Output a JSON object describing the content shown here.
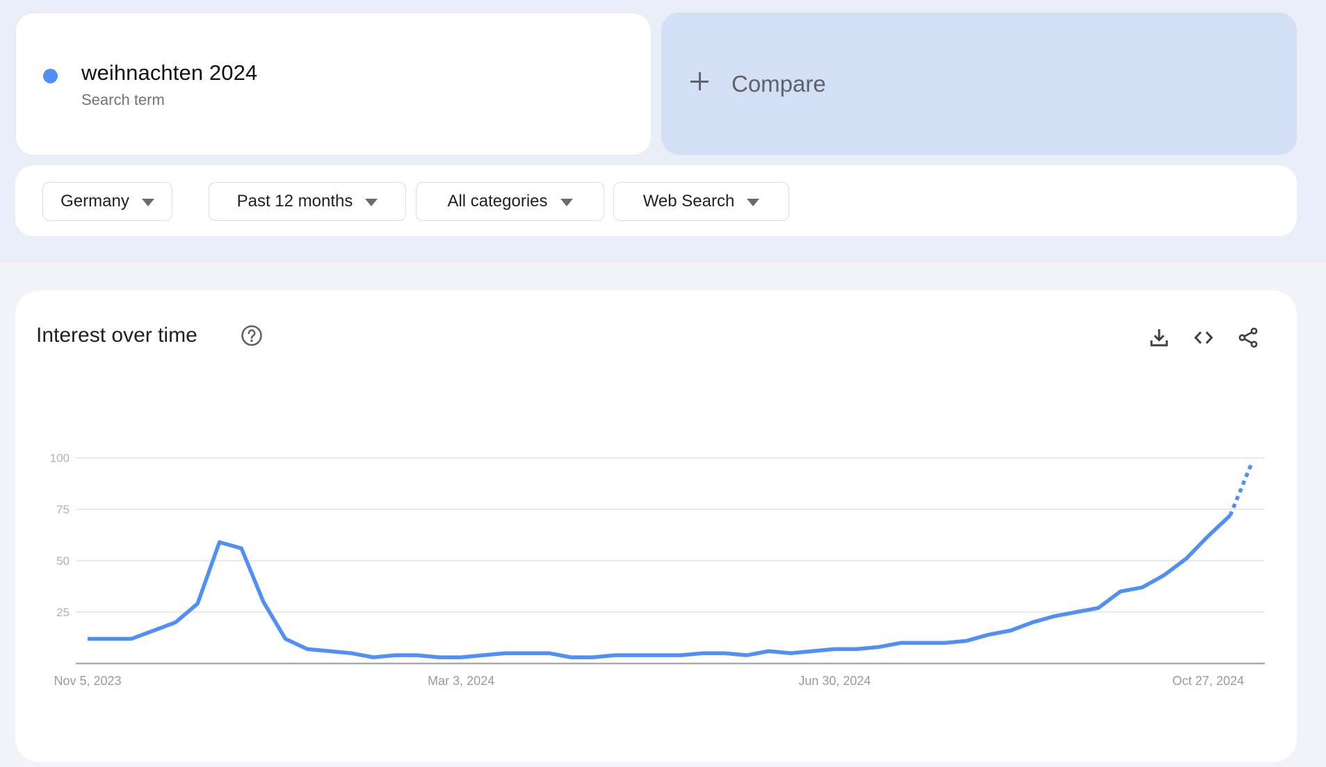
{
  "search_term": {
    "name": "weihnachten 2024",
    "type": "Search term",
    "color": "#4f8ff7"
  },
  "compare": {
    "label": "Compare",
    "icon": "plus-icon"
  },
  "filters": [
    {
      "label": "Germany",
      "icon": "caret-down-icon"
    },
    {
      "label": "Past 12 months",
      "icon": "caret-down-icon"
    },
    {
      "label": "All categories",
      "icon": "caret-down-icon"
    },
    {
      "label": "Web Search",
      "icon": "caret-down-icon"
    }
  ],
  "chart_panel": {
    "title": "Interest over time",
    "help_icon": "help-circle-icon",
    "actions": [
      {
        "name": "download",
        "icon": "download-icon"
      },
      {
        "name": "embed",
        "icon": "code-icon"
      },
      {
        "name": "share",
        "icon": "share-icon"
      }
    ]
  },
  "chart_data": {
    "type": "line",
    "title": "Interest over time",
    "xlabel": "",
    "ylabel": "",
    "ylim": [
      0,
      100
    ],
    "yticks": [
      25,
      50,
      75,
      100
    ],
    "grid": true,
    "x_tick_labels": [
      {
        "label": "Nov 5, 2023",
        "index": 0
      },
      {
        "label": "Mar 3, 2024",
        "index": 17
      },
      {
        "label": "Jun 30, 2024",
        "index": 34
      },
      {
        "label": "Oct 27, 2024",
        "index": 51
      }
    ],
    "series": [
      {
        "name": "weihnachten 2024",
        "color": "#4f8ff7",
        "values": [
          12,
          12,
          12,
          16,
          20,
          29,
          59,
          56,
          30,
          12,
          7,
          6,
          5,
          3,
          4,
          4,
          3,
          3,
          4,
          5,
          5,
          5,
          3,
          3,
          4,
          4,
          4,
          4,
          5,
          5,
          4,
          6,
          5,
          6,
          7,
          7,
          8,
          10,
          10,
          10,
          11,
          14,
          16,
          20,
          23,
          25,
          27,
          35,
          37,
          43,
          51,
          62,
          72,
          98
        ],
        "partial_last_point": true
      }
    ]
  }
}
